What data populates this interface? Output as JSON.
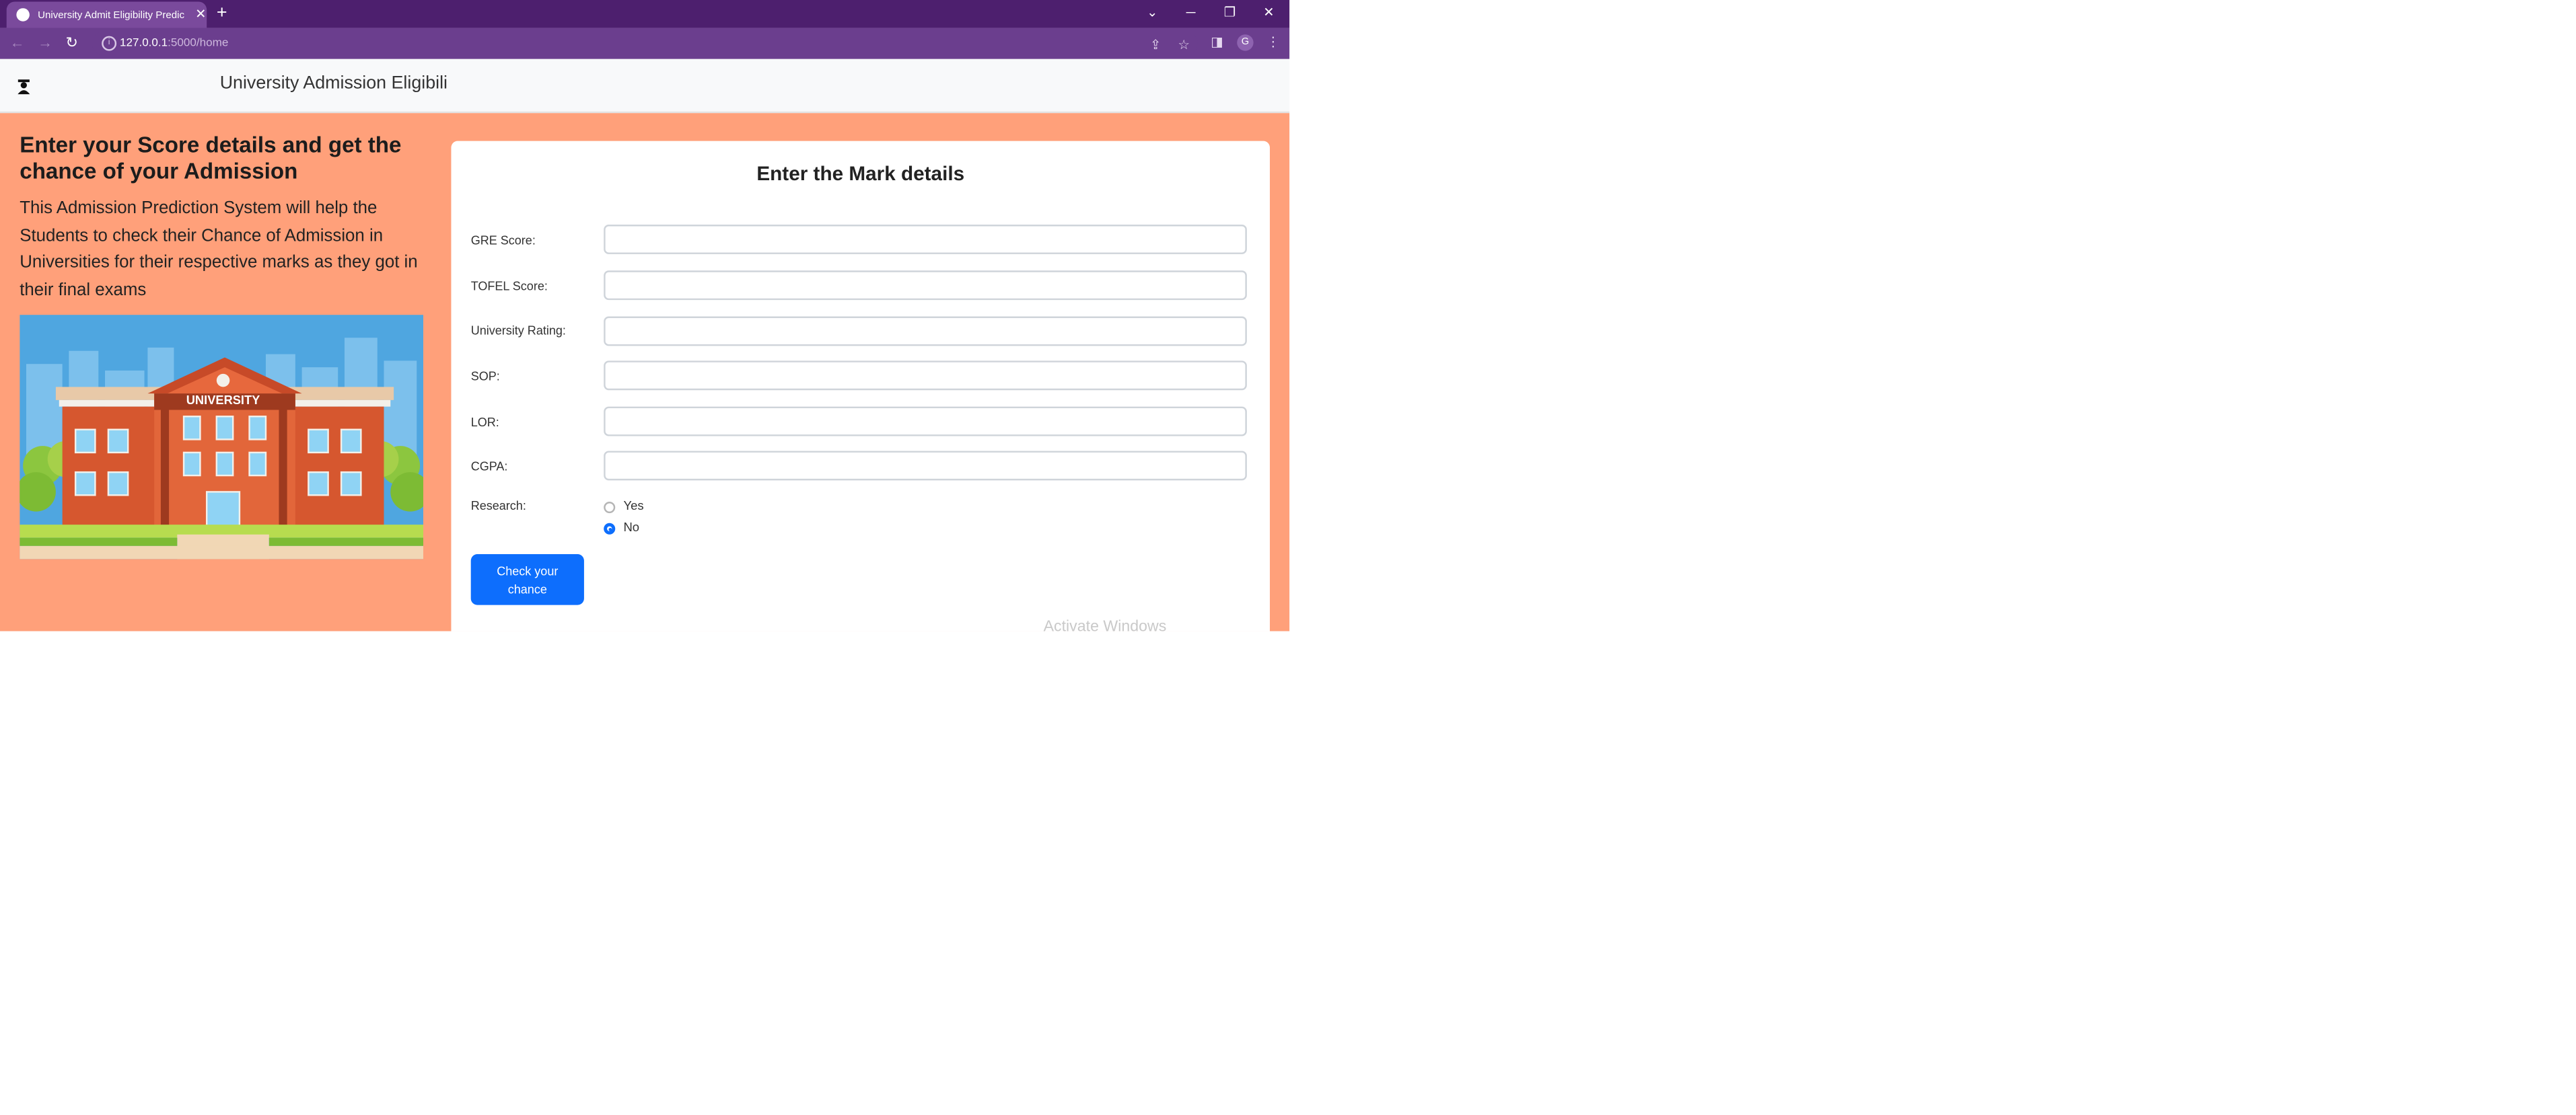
{
  "browser": {
    "tab_title": "University Admit Eligibility Predic",
    "url_host": "127.0.0.1",
    "url_path": ":5000/home",
    "profile_initial": "G"
  },
  "navbar": {
    "brand_icon": "graduate-icon",
    "title": "University Admission Eligibili"
  },
  "hero": {
    "heading": "Enter your Score details and get the chance of your Admission",
    "description": "This Admission Prediction System will help the Students to check their Chance of Admission in Universities for their respective marks as they got in their final exams",
    "illustration_sign": "UNIVERSITY"
  },
  "form": {
    "title": "Enter the Mark details",
    "fields": [
      {
        "label": "GRE Score:",
        "value": ""
      },
      {
        "label": "TOFEL Score:",
        "value": ""
      },
      {
        "label": "University Rating:",
        "value": ""
      },
      {
        "label": "SOP:",
        "value": ""
      },
      {
        "label": "LOR:",
        "value": ""
      },
      {
        "label": "CGPA:",
        "value": ""
      }
    ],
    "research": {
      "label": "Research:",
      "options": [
        "Yes",
        "No"
      ],
      "selected": "No"
    },
    "submit_label": "Check your chance"
  },
  "watermark": "Activate Windows",
  "colors": {
    "tabbar": "#4d1f6e",
    "addressbar": "#6b3e8e",
    "hero_bg": "#ffa07a",
    "primary": "#0d6efd"
  }
}
